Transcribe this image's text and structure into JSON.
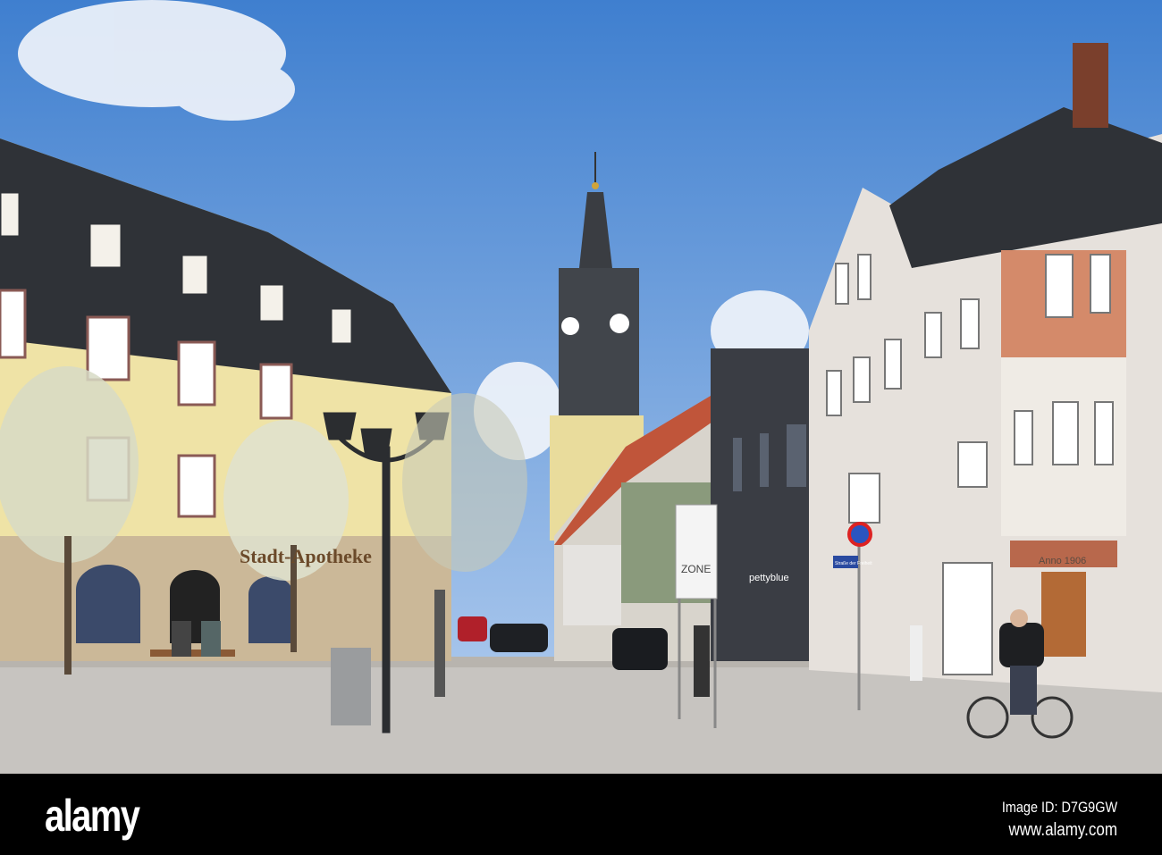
{
  "photo": {
    "signs": {
      "pharmacy": "Stadt-Apotheke",
      "shop": "pettyblue",
      "zone": "ZONE",
      "year": "Anno 1906",
      "street": "Straße der Freiheit"
    },
    "colors": {
      "sky_top": "#3f7fcf",
      "sky_bottom": "#a8c6ec",
      "facade_yellow": "#efe3a6",
      "roof": "#2f3237",
      "ground": "#c7c4c0"
    }
  },
  "watermark": {
    "logo": "alamy",
    "image_id": "Image ID: D7G9GW",
    "url": "www.alamy.com"
  }
}
